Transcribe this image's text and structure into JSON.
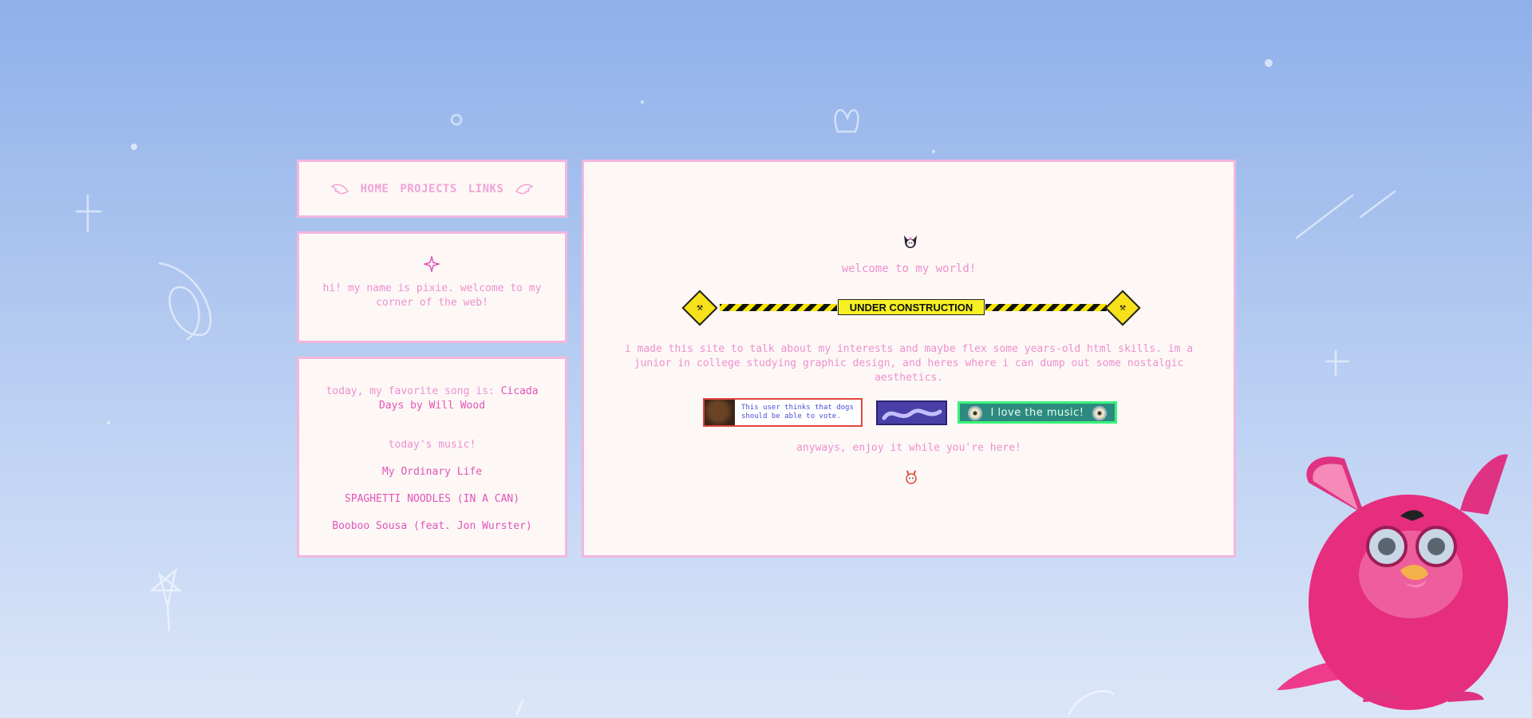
{
  "nav": {
    "items": [
      {
        "label": "HOME"
      },
      {
        "label": "PROJECTS"
      },
      {
        "label": "LINKS"
      }
    ]
  },
  "intro": {
    "text": "hi! my name is pixie. welcome to my corner of the web!"
  },
  "music": {
    "favorite_prefix": "today, my favorite song is:",
    "favorite_song": "Cicada Days",
    "favorite_by": "by Will Wood",
    "today_heading": "today's music!",
    "tracks": [
      {
        "title": "My Ordinary Life"
      },
      {
        "title": "SPAGHETTI NOODLES (IN A CAN)"
      },
      {
        "title": "Booboo Sousa (feat. Jon Wurster)"
      }
    ]
  },
  "main": {
    "welcome": "welcome to my world!",
    "construction_label": "UNDER CONSTRUCTION",
    "body": "i made this site to talk about my interests and maybe flex some years-old html skills. im a junior in college studying graphic design, and heres where i can dump out some nostalgic aesthetics.",
    "stamps": {
      "dogs_text": "This user thinks that dogs should be able to vote.",
      "music_text": "I love the music!"
    },
    "enjoy": "anyways, enjoy it while you're here!"
  },
  "colors": {
    "panel_bg": "#fdf8f6",
    "panel_border": "#f3b6df",
    "text_pink": "#ee8fcf",
    "text_hot_pink": "#e254b8"
  }
}
